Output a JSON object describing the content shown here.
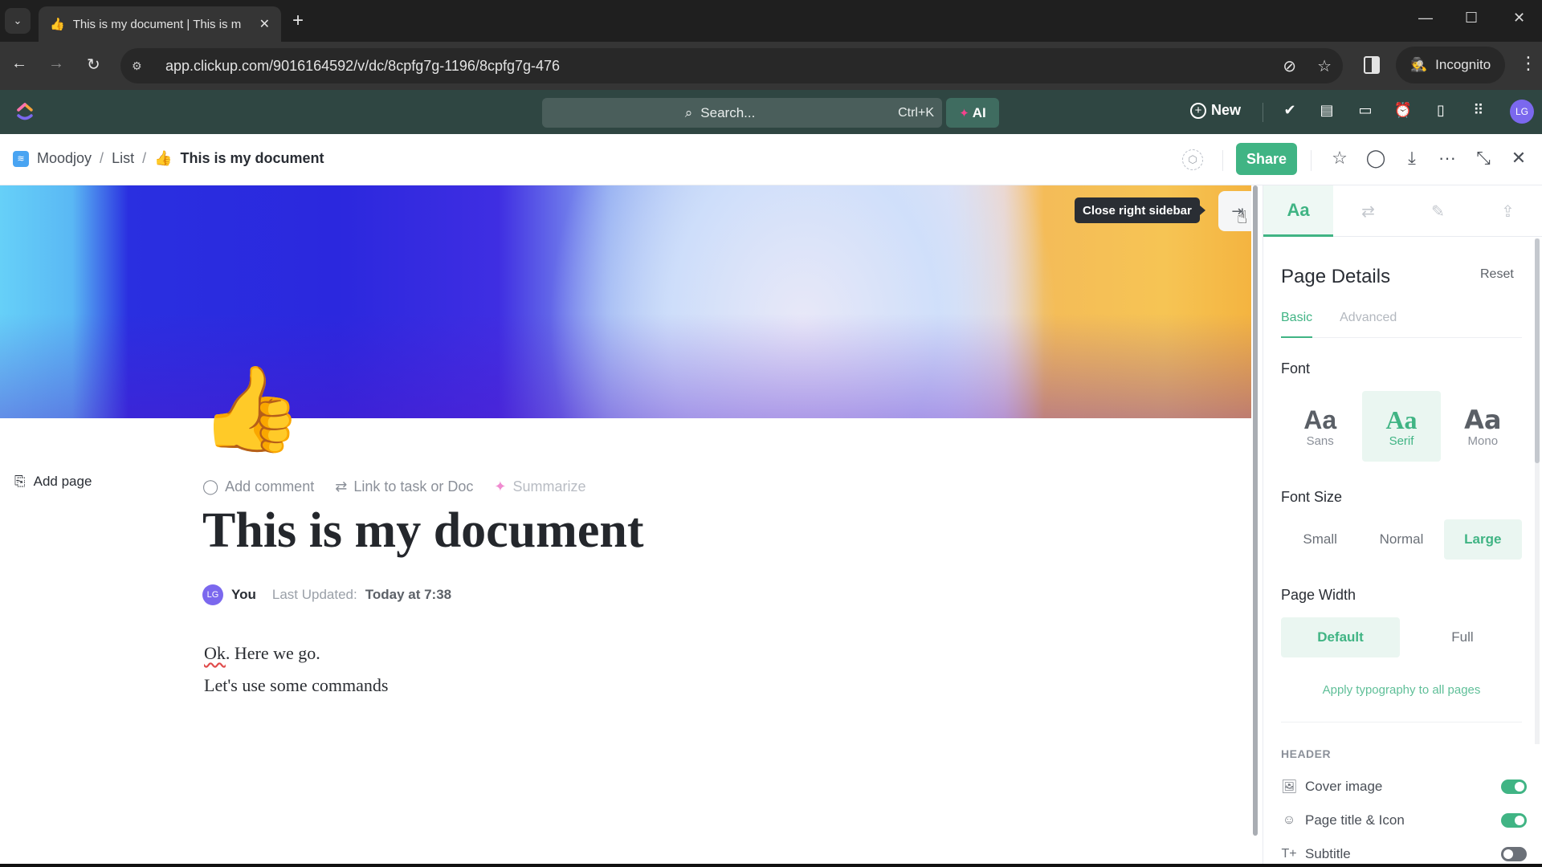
{
  "browser": {
    "tab_title": "This is my document | This is m",
    "tab_favicon": "👍",
    "url": "app.clickup.com/9016164592/v/dc/8cpfg7g-1196/8cpfg7g-476",
    "incognito_label": "Incognito",
    "icons": {
      "tab_search": "⌄",
      "tab_close": "✕",
      "new_tab": "+",
      "minimize": "—",
      "maximize": "☐",
      "close": "✕",
      "back": "←",
      "forward": "→",
      "reload": "↻",
      "site_info": "⚙",
      "eye_off": "⊘",
      "bookmark": "☆",
      "incognito": "🕵",
      "menu": "⋮"
    }
  },
  "appbar": {
    "search_placeholder": "Search...",
    "search_shortcut": "Ctrl+K",
    "ai_label": "AI",
    "new_label": "New",
    "avatar_initials": "LG",
    "icons": {
      "search": "⌕",
      "ai_spark": "✦",
      "new_plus": "+",
      "tasks": "✔",
      "notepad": "▤",
      "video": "▭",
      "alarm": "⏰",
      "docs": "▯",
      "apps": "⠿"
    }
  },
  "docbar": {
    "breadcrumb": [
      {
        "label": "Moodjoy",
        "icon": "📶"
      },
      {
        "label": "List"
      },
      {
        "label": "This is my document",
        "icon": "👍"
      }
    ],
    "separator": "/",
    "share_label": "Share",
    "icons": {
      "tag": "⌂",
      "star": "☆",
      "comment": "◯",
      "export": "⤓",
      "more": "···",
      "collapse": "⤡",
      "close": "✕"
    }
  },
  "cover": {
    "tooltip": "Close right sidebar",
    "close_sidebar_icon": "⇥",
    "colors": [
      "#66d0f8",
      "#2a2fe0",
      "#cadcf8",
      "#f6c454"
    ]
  },
  "document": {
    "page_icon": "👍",
    "add_page_label": "Add page",
    "actions": [
      {
        "label": "Add comment",
        "icon": "◯"
      },
      {
        "label": "Link to task or Doc",
        "icon": "⇄"
      },
      {
        "label": "Summarize",
        "icon": "✦"
      }
    ],
    "title": "This is my document",
    "author_initials": "LG",
    "author": "You",
    "last_updated_label": "Last Updated:",
    "last_updated_value": "Today at 7:38",
    "body": {
      "line1_misspelled": "Ok",
      "line1_rest": ". Here we go.",
      "line2": "Let's use some commands"
    }
  },
  "sidebar": {
    "tabs": [
      {
        "label": "Aa",
        "active": true
      },
      {
        "icon": "⇄"
      },
      {
        "icon": "✎"
      },
      {
        "icon": "⇪"
      }
    ],
    "title": "Page Details",
    "reset_label": "Reset",
    "subtabs": [
      {
        "label": "Basic",
        "active": true
      },
      {
        "label": "Advanced"
      }
    ],
    "font_label": "Font",
    "fonts": [
      {
        "glyph": "Aa",
        "name": "Sans"
      },
      {
        "glyph": "Aa",
        "name": "Serif",
        "selected": true
      },
      {
        "glyph": "Aa",
        "name": "Mono"
      }
    ],
    "font_size_label": "Font Size",
    "font_sizes": [
      {
        "label": "Small"
      },
      {
        "label": "Normal"
      },
      {
        "label": "Large",
        "selected": true
      }
    ],
    "page_width_label": "Page Width",
    "page_widths": [
      {
        "label": "Default",
        "selected": true
      },
      {
        "label": "Full"
      }
    ],
    "apply_label": "Apply typography to all pages",
    "header_section": "HEADER",
    "toggles": [
      {
        "label": "Cover image",
        "icon": "🖼",
        "on": true
      },
      {
        "label": "Page title & Icon",
        "icon": "☺",
        "on": true
      },
      {
        "label": "Subtitle",
        "icon": "T+",
        "on": false
      }
    ]
  },
  "colors": {
    "accent": "#40b484",
    "appbar": "#2f4642",
    "avatar": "#7b68ee"
  }
}
